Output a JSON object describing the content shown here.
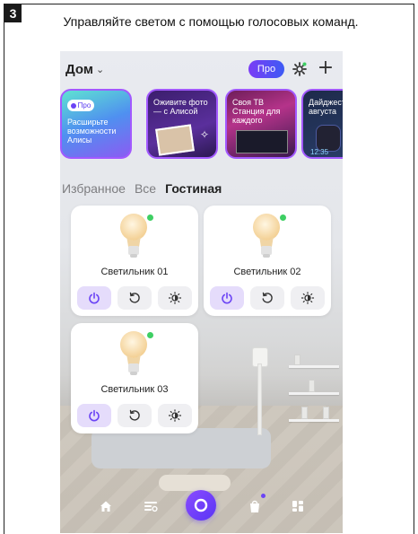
{
  "step_number": "3",
  "caption": "Управляйте светом с помощью голосовых команд.",
  "app": {
    "home_title": "Дом",
    "pro_label": "Про",
    "stories": [
      {
        "badge": "Про",
        "text": "Расширьте возможности Алисы"
      },
      {
        "text": "Оживите фото — с Алисой"
      },
      {
        "text": "Своя ТВ Станция для каждого"
      },
      {
        "text": "Дайджест августа",
        "clock": "12:35"
      }
    ],
    "tabs": [
      "Избранное",
      "Все",
      "Гостиная"
    ],
    "active_tab": "Гостиная",
    "devices": [
      {
        "name": "Светильник 01",
        "status": "online"
      },
      {
        "name": "Светильник 02",
        "status": "online"
      },
      {
        "name": "Светильник 03",
        "status": "online"
      }
    ],
    "accent_color": "#6b44f5",
    "online_color": "#3ecf63"
  }
}
